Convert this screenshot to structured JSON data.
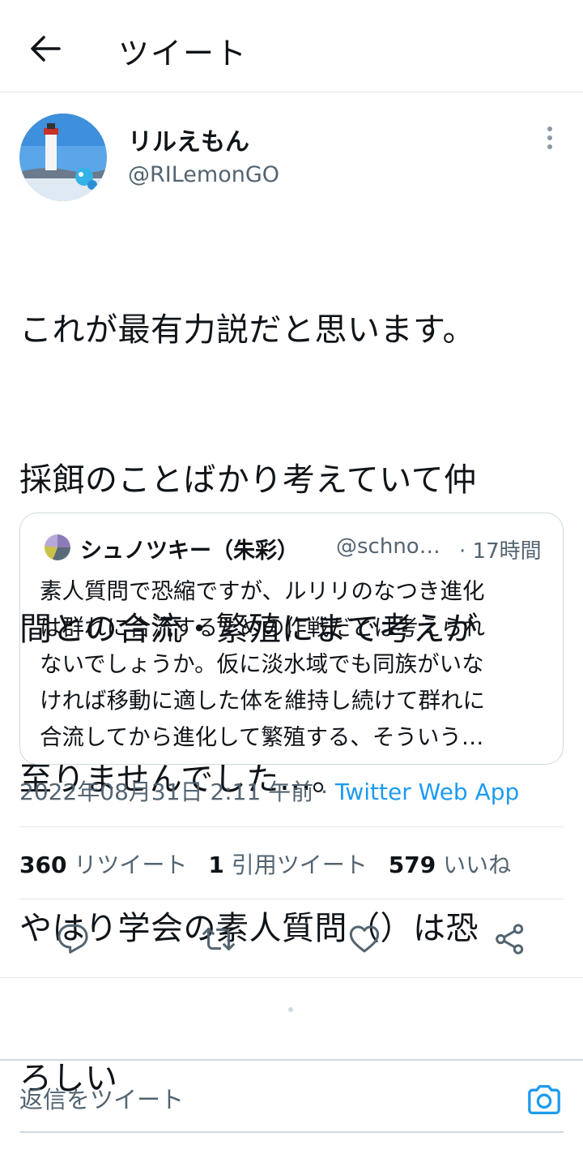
{
  "header": {
    "title": "ツイート"
  },
  "author": {
    "name": "リルえもん",
    "handle": "@RILemonGO"
  },
  "tweet": {
    "lines": [
      "これが最有力説だと思います。",
      "採餌のことばかり考えていて仲",
      "間との合流・繁殖にまで考えが",
      "至りませんでした…。",
      "やはり学会の素人質問（）は恐",
      "ろしい"
    ]
  },
  "quote": {
    "name": "シュノツキー（朱彩）",
    "handle": "@schno…",
    "time": "· 17時間",
    "lines": [
      "素人質問で恐縮ですが、ルリリのなつき進化",
      "は群れに合流するための作戦だとは考えられ",
      "ないでしょうか。仮に淡水域でも同族がいな",
      "ければ移動に適した体を維持し続けて群れに",
      "合流してから進化して繁殖する、そういう…"
    ]
  },
  "meta": {
    "datetime": "2022年08月31日 2:11 午前",
    "separator": " · ",
    "app": "Twitter Web App"
  },
  "stats": {
    "retweets": {
      "count": "360",
      "label": "リツイート"
    },
    "quotes": {
      "count": "1",
      "label": "引用ツイート"
    },
    "likes": {
      "count": "579",
      "label": "いいね"
    }
  },
  "actions": [
    "reply-icon",
    "retweet-icon",
    "like-icon",
    "share-icon"
  ],
  "reply": {
    "placeholder": "返信をツイート"
  },
  "colors": {
    "accent": "#1d9bf0",
    "text": "#0f1419",
    "secondary": "#536471",
    "border": "#cfd9de"
  }
}
